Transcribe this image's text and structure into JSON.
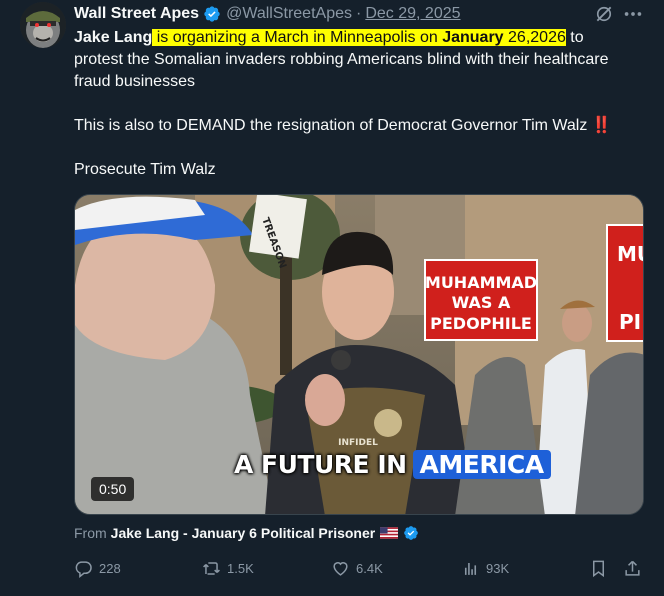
{
  "tweet": {
    "author_name": "Wall Street Apes",
    "handle": "@WallStreetApes",
    "separator": "·",
    "date": "Dec 29, 2025",
    "body": {
      "line1_bold": "Jake Lang",
      "line1_highlight": " is organizing a March in Minneapolis on ",
      "line1_date_bold": "January",
      "line1_date_rest": " 26,2026",
      "line1_after": " to protest the Somalian invaders robbing Americans blind with their healthcare fraud businesses",
      "paragraph2": "This is also to DEMAND the resignation of Democrat Governor Tim Walz ",
      "paragraph2_emoji": "‼️",
      "paragraph3": "Prosecute Tim Walz"
    },
    "media": {
      "duration": "0:50",
      "caption_part1": "A FUTURE IN",
      "caption_part2": "AMERICA",
      "sign_text_1": "MUHAMMAD",
      "sign_text_2": "WAS A",
      "sign_text_3": "PEDOPHILE",
      "sign_text_right": "MU",
      "sign_text_right_2": "PI",
      "patch_text": "INFIDEL",
      "sign_left_text": "TREASON"
    },
    "from": {
      "prefix": "From",
      "source_name": "Jake Lang - January 6 Political Prisoner"
    },
    "actions": {
      "replies": "228",
      "reposts": "1.5K",
      "likes": "6.4K",
      "views": "93K"
    }
  },
  "colors": {
    "background": "#15202b",
    "text_secondary": "#8b98a5",
    "verified_blue": "#1d9bf0",
    "highlight": "#ffff00",
    "caption_blue": "#1e60d8",
    "sign_red": "#d0201c"
  },
  "icons": [
    "verified-badge-icon",
    "grok-icon",
    "more-icon",
    "reply-icon",
    "repost-icon",
    "like-icon",
    "views-icon",
    "bookmark-icon",
    "share-icon",
    "us-flag-icon"
  ]
}
